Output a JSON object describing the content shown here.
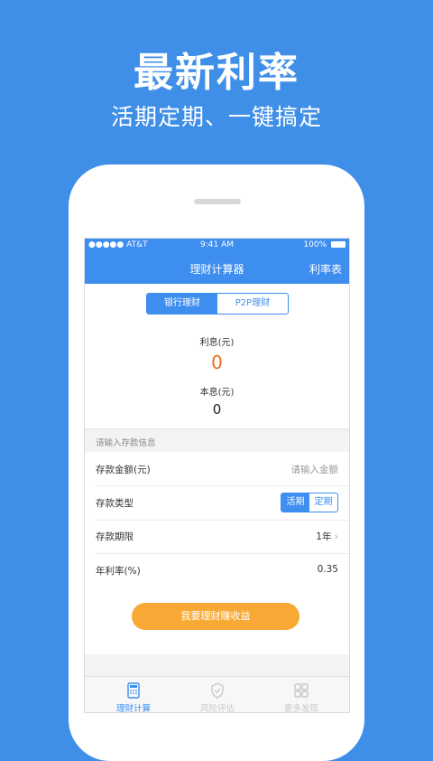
{
  "promo": {
    "title": "最新利率",
    "subtitle": "活期定期、一键搞定"
  },
  "status_bar": {
    "carrier": "●●●●● AT&T",
    "time": "9:41 AM",
    "battery": "100%"
  },
  "nav": {
    "title": "理财计算器",
    "right_link": "利率表"
  },
  "segment": {
    "options": [
      "银行理财",
      "P2P理财"
    ],
    "selected": "银行理财"
  },
  "result": {
    "interest_label": "利息(元)",
    "interest_value": "0",
    "principal_interest_label": "本息(元)",
    "principal_interest_value": "0"
  },
  "info_strip": "请输入存款信息",
  "form": {
    "amount_label": "存款金额(元)",
    "amount_placeholder": "请输入金额",
    "type_label": "存款类型",
    "type_options": [
      "活期",
      "定期"
    ],
    "type_selected": "活期",
    "term_label": "存款期限",
    "term_value": "1年",
    "rate_label": "年利率(%)",
    "rate_value": "0.35"
  },
  "cta_button": "我要理财赚收益",
  "tabbar": {
    "items": [
      "理财计算",
      "风险评估",
      "更多发现"
    ],
    "active": "理财计算"
  },
  "colors": {
    "background": "#3f8fe8",
    "accent": "#3e8ef0",
    "cta": "#f8a935",
    "interest": "#f06b1f"
  }
}
